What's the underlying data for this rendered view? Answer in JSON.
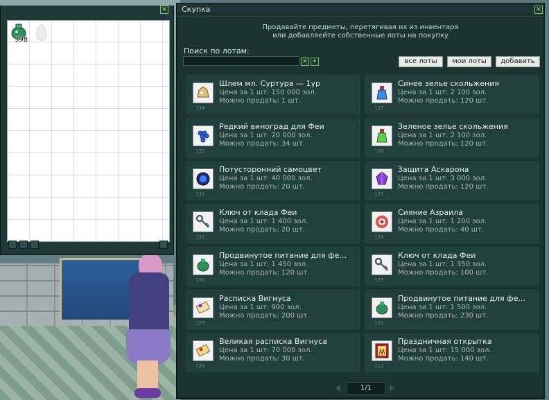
{
  "inventory": {
    "slots": [
      {
        "icon": "potion-bag-icon",
        "count": "398"
      },
      {
        "icon": "empty-egg-icon",
        "count": ""
      }
    ]
  },
  "window": {
    "title": "Скупка",
    "hint_line1": "Продавайте предметы, перетягивая их из инвентаря",
    "hint_line2": "или добавляейте собственные лоты на покупку"
  },
  "search": {
    "label": "Поиск по лотам:",
    "value": "",
    "placeholder": ""
  },
  "buttons": {
    "all": "все лоты",
    "mine": "мои лоты",
    "add": "добавить"
  },
  "lots": [
    {
      "id": "134",
      "name": "Шлем мл. Суртура — 1ур",
      "price": "Цена за 1 шт: 150 000 зол.",
      "qty": "Можно продать: 1 шт.",
      "icon": "helmet-icon"
    },
    {
      "id": "127",
      "name": "Синее зелье скольжения",
      "price": "Цена за 1 шт: 2 100 зол.",
      "qty": "Можно продать: 120 шт.",
      "icon": "blue-potion-icon"
    },
    {
      "id": "133",
      "name": "Редкий виноград для Феи",
      "price": "Цена за 1 шт: 20 000 зол.",
      "qty": "Можно продать: 34 шт.",
      "icon": "grape-icon"
    },
    {
      "id": "126",
      "name": "Зеленое зелье скольжения",
      "price": "Цена за 1 шт: 2 100 зол.",
      "qty": "Можно продать: 120 шт.",
      "icon": "green-potion-icon"
    },
    {
      "id": "132",
      "name": "Потусторонний самоцвет",
      "price": "Цена за 1 шт: 40 000 зол.",
      "qty": "Можно продать: 20 шт.",
      "icon": "gem-icon"
    },
    {
      "id": "125",
      "name": "Защита Аскарона",
      "price": "Цена за 1 шт: 3 000 зол.",
      "qty": "Можно продать: 120 шт.",
      "icon": "crystal-icon"
    },
    {
      "id": "131",
      "name": "Ключ от клада Феи",
      "price": "Цена за 1 шт: 1 400 зол.",
      "qty": "Можно продать: 20 шт.",
      "icon": "key-icon"
    },
    {
      "id": "124",
      "name": "Сияние Азраила",
      "price": "Цена за 1 шт: 1 200 зол.",
      "qty": "Можно продать: 40 шт.",
      "icon": "radiance-icon"
    },
    {
      "id": "130",
      "name": "Продвинутое питание для фе...",
      "price": "Цена за 1 шт: 1 450 зол.",
      "qty": "Можно продать: 120 шт.",
      "icon": "food-bag-icon"
    },
    {
      "id": "123",
      "name": "Ключ от клада Феи",
      "price": "Цена за 1 шт: 1 350 зол.",
      "qty": "Можно продать: 100 шт.",
      "icon": "key-icon"
    },
    {
      "id": "129",
      "name": "Расписка Вигнуса",
      "price": "Цена за 1 шт: 900 зол.",
      "qty": "Можно продать: 200 шт.",
      "icon": "scroll-icon"
    },
    {
      "id": "122",
      "name": "Продвинутое питание для фе...",
      "price": "Цена за 1 шт: 1 500 зол.",
      "qty": "Можно продать: 230 шт.",
      "icon": "food-bag-icon"
    },
    {
      "id": "128",
      "name": "Великая расписка Вигнуса",
      "price": "Цена за 1 шт: 70 000 зол.",
      "qty": "Можно продать: 30 шт.",
      "icon": "big-scroll-icon"
    },
    {
      "id": "112",
      "name": "Праздничная открытка",
      "price": "Цена за 1 шт: 15 000 зол.",
      "qty": "Можно продать: 140 шт.",
      "icon": "postcard-icon"
    }
  ],
  "pager": {
    "label": "1/1"
  }
}
